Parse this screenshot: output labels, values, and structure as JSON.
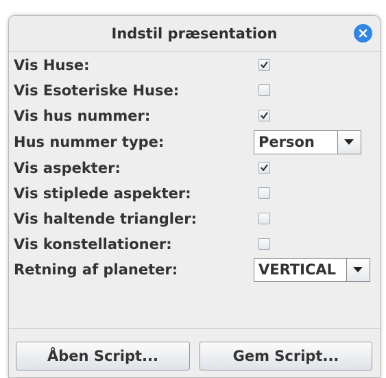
{
  "dialog": {
    "title": "Indstil præsentation",
    "close_icon": "close-icon"
  },
  "settings": {
    "show_houses": {
      "label": "Vis Huse:",
      "checked": true
    },
    "show_esoteric_houses": {
      "label": "Vis Esoteriske Huse:",
      "checked": false
    },
    "show_house_number": {
      "label": "Vis hus nummer:",
      "checked": true
    },
    "house_number_type": {
      "label": "Hus nummer type:",
      "value": "Person"
    },
    "show_aspects": {
      "label": "Vis aspekter:",
      "checked": true
    },
    "show_dotted_aspects": {
      "label": "Vis stiplede aspekter:",
      "checked": false
    },
    "show_limping_triangles": {
      "label": "Vis haltende triangler:",
      "checked": false
    },
    "show_constellations": {
      "label": "Vis konstellationer:",
      "checked": false
    },
    "planet_direction": {
      "label": "Retning af planeter:",
      "value": "VERTICAL"
    }
  },
  "buttons": {
    "open_script": "Åben Script...",
    "save_script": "Gem Script..."
  },
  "colors": {
    "close_button": "#2f86e6",
    "dialog_background": "#eeeeee",
    "text": "#333333"
  }
}
